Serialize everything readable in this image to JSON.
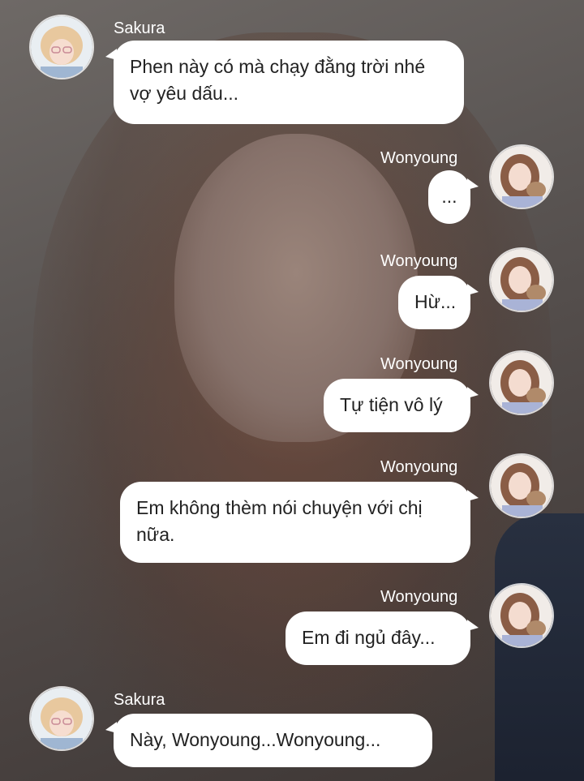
{
  "messages": [
    {
      "sender": "Sakura",
      "text": "Phen này có mà chạy đằng trời nhé vợ yêu dấu..."
    },
    {
      "sender": "Wonyoung",
      "text": "..."
    },
    {
      "sender": "Wonyoung",
      "text": "Hừ..."
    },
    {
      "sender": "Wonyoung",
      "text": "Tự tiện vô lý"
    },
    {
      "sender": "Wonyoung",
      "text": "Em không thèm nói chuyện với chị nữa."
    },
    {
      "sender": "Wonyoung",
      "text": "Em đi ngủ đây..."
    },
    {
      "sender": "Sakura",
      "text": "Này, Wonyoung...Wonyoung..."
    }
  ],
  "colors": {
    "bubble": "#ffffff",
    "name_text": "#ffffff",
    "message_text": "#222222"
  },
  "icons": {
    "sakura_avatar": "avatar-sakura-icon",
    "wonyoung_avatar": "avatar-wonyoung-icon"
  }
}
